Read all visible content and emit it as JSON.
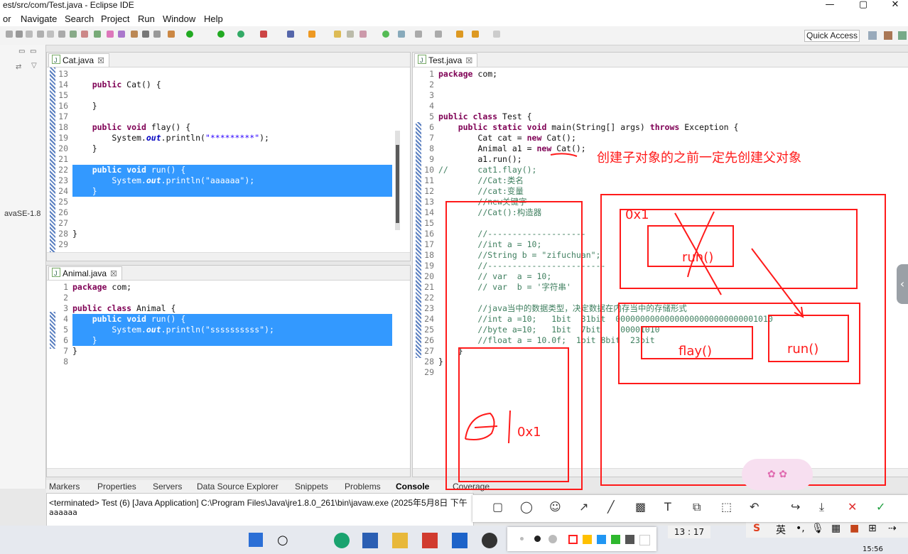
{
  "window": {
    "title": "est/src/com/Test.java - Eclipse IDE"
  },
  "menu": [
    "or",
    "Navigate",
    "Search",
    "Project",
    "Run",
    "Window",
    "Help"
  ],
  "toolbar": {
    "quick_access": "Quick Access"
  },
  "left_panel": {
    "jre_label": "avaSE-1.8"
  },
  "cat_editor": {
    "tab": "Cat.java",
    "lines": [
      {
        "n": "13",
        "t": ""
      },
      {
        "n": "14",
        "t": "    public Cat() {"
      },
      {
        "n": "15",
        "t": ""
      },
      {
        "n": "16",
        "t": "    }"
      },
      {
        "n": "17",
        "t": ""
      },
      {
        "n": "18",
        "t": "    public void flay() {"
      },
      {
        "n": "19",
        "t": "        System.out.println(\"*********\");"
      },
      {
        "n": "20",
        "t": "    }"
      },
      {
        "n": "21",
        "t": ""
      },
      {
        "n": "22",
        "t": "    public void run() {"
      },
      {
        "n": "23",
        "t": "        System.out.println(\"aaaaaa\");"
      },
      {
        "n": "24",
        "t": "    }"
      },
      {
        "n": "25",
        "t": ""
      },
      {
        "n": "26",
        "t": ""
      },
      {
        "n": "27",
        "t": ""
      },
      {
        "n": "28",
        "t": "}"
      },
      {
        "n": "29",
        "t": ""
      }
    ]
  },
  "animal_editor": {
    "tab": "Animal.java",
    "lines": [
      {
        "n": "1",
        "t": "package com;"
      },
      {
        "n": "2",
        "t": ""
      },
      {
        "n": "3",
        "t": "public class Animal {"
      },
      {
        "n": "4",
        "t": "    public void run() {"
      },
      {
        "n": "5",
        "t": "        System.out.println(\"ssssssssss\");"
      },
      {
        "n": "6",
        "t": "    }"
      },
      {
        "n": "7",
        "t": "}"
      },
      {
        "n": "8",
        "t": ""
      }
    ]
  },
  "test_editor": {
    "tab": "Test.java",
    "lines": [
      {
        "n": "1",
        "t": "package com;"
      },
      {
        "n": "2",
        "t": ""
      },
      {
        "n": "3",
        "t": ""
      },
      {
        "n": "4",
        "t": ""
      },
      {
        "n": "5",
        "t": "public class Test {"
      },
      {
        "n": "6",
        "t": "    public static void main(String[] args) throws Exception {"
      },
      {
        "n": "7",
        "t": "        Cat cat = new Cat();"
      },
      {
        "n": "8",
        "t": "        Animal a1 = new Cat();"
      },
      {
        "n": "9",
        "t": "        a1.run();"
      },
      {
        "n": "10",
        "t": "//      cat1.flay();"
      },
      {
        "n": "11",
        "t": "        //Cat:类名"
      },
      {
        "n": "12",
        "t": "        //cat:变量"
      },
      {
        "n": "13",
        "t": "        //new关键字"
      },
      {
        "n": "14",
        "t": "        //Cat():构造器"
      },
      {
        "n": "15",
        "t": ""
      },
      {
        "n": "16",
        "t": "        //--------------------"
      },
      {
        "n": "17",
        "t": "        //int a = 10;"
      },
      {
        "n": "18",
        "t": "        //String b = \"zifuchuan\";"
      },
      {
        "n": "19",
        "t": "        //------------------------"
      },
      {
        "n": "20",
        "t": "        // var  a = 10;"
      },
      {
        "n": "21",
        "t": "        // var  b = '字符串'"
      },
      {
        "n": "22",
        "t": ""
      },
      {
        "n": "23",
        "t": "        //java当中的数据类型，决定数据在内存当中的存储形式"
      },
      {
        "n": "24",
        "t": "        //int a =10;   1bit  31bit  00000000000000000000000000001010"
      },
      {
        "n": "25",
        "t": "        //byte a=10;   1bit  7bit    00001010"
      },
      {
        "n": "26",
        "t": "        //float a = 10.0f;  1bit 8bit  23bit"
      },
      {
        "n": "27",
        "t": "    }"
      },
      {
        "n": "28",
        "t": "}"
      },
      {
        "n": "29",
        "t": ""
      }
    ]
  },
  "bottom_tabs": [
    "Markers",
    "Properties",
    "Servers",
    "Data Source Explorer",
    "Snippets",
    "Problems",
    "Console",
    "Coverage"
  ],
  "console": {
    "header": "<terminated> Test (6) [Java Application] C:\\Program Files\\Java\\jre1.8.0_261\\bin\\javaw.exe (2025年5月8日 下午",
    "output": "aaaaaa"
  },
  "annotations": {
    "note": "创建子对象的之前一定先创建父对象",
    "heap_addr": "0x1",
    "stack_addr": "0x1",
    "parent_method": "run()",
    "child_method_flay": "flay()",
    "child_method_run": "run()",
    "stack_var": "a1",
    "color": "#ff1a1a"
  },
  "status": {
    "time_left": "13 : 17",
    "clock": "15:56"
  },
  "ime": {
    "lang": "英"
  },
  "annot_tools": [
    "rect",
    "circle",
    "emoji",
    "arrow",
    "line",
    "mosaic",
    "text",
    "layers",
    "blur",
    "undo",
    "share",
    "save",
    "close",
    "done"
  ],
  "palette_colors": [
    "#ff2020",
    "#ffc000",
    "#2196f3",
    "#2eb82e",
    "#555555",
    "#ffffff"
  ]
}
